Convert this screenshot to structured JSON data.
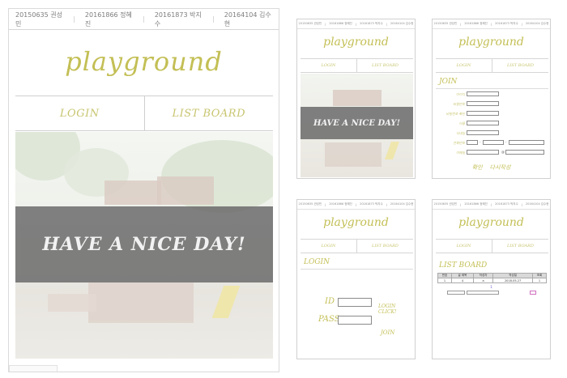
{
  "students": [
    "20150635 권성민",
    "20161866 정혜진",
    "20161873 박지수",
    "20164104 김수현"
  ],
  "brand": "playground",
  "nav": {
    "login": "LOGIN",
    "board": "LIST BOARD"
  },
  "banner": "HAVE A NICE DAY!",
  "join": {
    "title": "JOIN",
    "fields": [
      "아이디",
      "비밀번호",
      "비밀번호 확인",
      "이름",
      "닉네임",
      "전화번호",
      "이메일"
    ],
    "phone_sep": "-",
    "email_at": "@",
    "confirm": "확인",
    "rewrite": "다시작성"
  },
  "login": {
    "title": "LOGIN",
    "id_label": "ID",
    "pass_label": "PASS",
    "submit": "LOGIN CLICK!",
    "join": "JOIN"
  },
  "board": {
    "title": "LIST BOARD",
    "columns": [
      "번호",
      "글 제목",
      "작성자",
      "작성일",
      "조회"
    ],
    "row": [
      "1",
      "4",
      "a",
      "2018-05-27",
      "1"
    ],
    "pager": "1"
  }
}
